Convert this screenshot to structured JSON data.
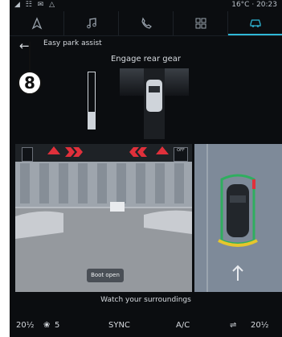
{
  "status": {
    "icons": "◢ ☷ ✉ △",
    "temperature": "16°C",
    "time": "20:23"
  },
  "tabs": [
    {
      "name": "navigation-icon"
    },
    {
      "name": "music-icon"
    },
    {
      "name": "phone-icon"
    },
    {
      "name": "apps-icon"
    },
    {
      "name": "car-icon",
      "active": true
    }
  ],
  "header": {
    "title": "Easy park assist"
  },
  "instruction": "Engage rear gear",
  "gear_gauge_fill": 0.3,
  "camera": {
    "boot_button": "Boot open",
    "off_label": "OFF"
  },
  "bottom_message": "Watch your surroundings",
  "climate": {
    "left_temp": "20½",
    "fan_level": "5",
    "sync": "SYNC",
    "ac": "A/C",
    "right_temp": "20½"
  },
  "callout": "8",
  "colors": {
    "accent": "#2fb7d6",
    "warning": "#e0303b",
    "sensor_yellow": "#e6c62c"
  }
}
